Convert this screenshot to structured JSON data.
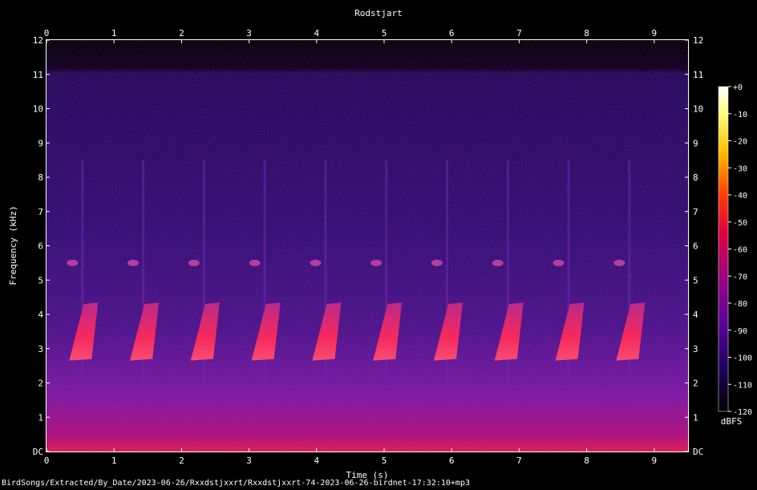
{
  "chart_data": {
    "type": "heatmap",
    "title": "Rodstjart",
    "xlabel": "Time (s)",
    "ylabel": "Frequency (kHz)",
    "x_ticks": [
      "0",
      "1",
      "2",
      "3",
      "4",
      "5",
      "6",
      "7",
      "8",
      "9"
    ],
    "y_ticks": [
      "DC",
      "1",
      "2",
      "3",
      "4",
      "5",
      "6",
      "7",
      "8",
      "9",
      "10",
      "11",
      "12"
    ],
    "xlim": [
      0,
      9.5
    ],
    "ylim": [
      0,
      12
    ],
    "colorbar": {
      "label": "dBFS",
      "ticks": [
        "+0",
        "-10",
        "-20",
        "-30",
        "-40",
        "-50",
        "-60",
        "-70",
        "-80",
        "-90",
        "-100",
        "-110",
        "-120"
      ],
      "range": [
        -120,
        0
      ]
    },
    "song_events": [
      {
        "t": 0.55,
        "start_khz": 4.3,
        "end_khz": 2.7
      },
      {
        "t": 1.45,
        "start_khz": 4.3,
        "end_khz": 2.7
      },
      {
        "t": 2.35,
        "start_khz": 4.3,
        "end_khz": 2.7
      },
      {
        "t": 3.25,
        "start_khz": 4.3,
        "end_khz": 2.7
      },
      {
        "t": 4.15,
        "start_khz": 4.3,
        "end_khz": 2.7
      },
      {
        "t": 5.05,
        "start_khz": 4.3,
        "end_khz": 2.7
      },
      {
        "t": 5.95,
        "start_khz": 4.3,
        "end_khz": 2.7
      },
      {
        "t": 6.85,
        "start_khz": 4.3,
        "end_khz": 2.7
      },
      {
        "t": 7.75,
        "start_khz": 4.3,
        "end_khz": 2.7
      },
      {
        "t": 8.65,
        "start_khz": 4.3,
        "end_khz": 2.7
      }
    ],
    "colors": {
      "background": "#000000",
      "noise_floor": "#2a0a5c",
      "low_band": "#7a1aa0",
      "call": "#ff2a5a",
      "peak": "#ffffff"
    }
  },
  "footer": {
    "path": "BirdSongs/Extracted/By_Date/2023-06-26/Rxxdstjxxrt/Rxxdstjxxrt-74-2023-06-26-birdnet-17:32:10+mp3"
  }
}
